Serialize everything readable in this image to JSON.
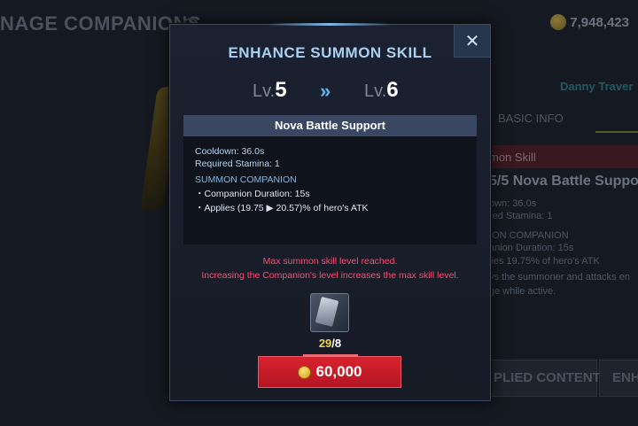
{
  "background": {
    "title": "NAGE COMPANIONS",
    "currency": {
      "icon": "gold-coin-icon",
      "value": "7,948,423"
    },
    "hero_name": "Danny Traver",
    "tab": "BASIC INFO",
    "red_bar_text": "mon Skill",
    "skill_title": "5/5  Nova Battle Suppo",
    "lines": [
      "own: 36.0s",
      "red Stamina: 1",
      "ION COMPANION",
      "anion Duration: 15s",
      "lies 19.75% of hero's ATK",
      "vs the summoner and attacks en",
      "ge while active."
    ],
    "button_applied": "PLIED CONTENT",
    "button_enhance": "ENH"
  },
  "modal": {
    "title": "ENHANCE SUMMON SKILL",
    "close_icon": "close-icon",
    "level_prefix": "Lv.",
    "level_from": "5",
    "level_to": "6",
    "arrow": "»",
    "skill_name": "Nova Battle Support",
    "cooldown": "Cooldown: 36.0s",
    "stamina": "Required Stamina: 1",
    "section": "SUMMON COMPANION",
    "duration": "・Companion Duration: 15s",
    "applies": "・Applies (19.75 ▶ 20.57)% of hero's ATK",
    "warning_1": "Max summon skill level reached.",
    "warning_2": "Increasing the Companion's level increases the max skill level.",
    "material": {
      "icon": "skill-card-icon",
      "have": "29",
      "separator": "/",
      "need": "8"
    },
    "price": {
      "icon": "gold-coin-icon",
      "value": "60,000"
    },
    "colors": {
      "accent": "#a8d0f0",
      "warning": "#ff4a6e",
      "button": "#d8232f",
      "count": "#f3d34a"
    }
  }
}
